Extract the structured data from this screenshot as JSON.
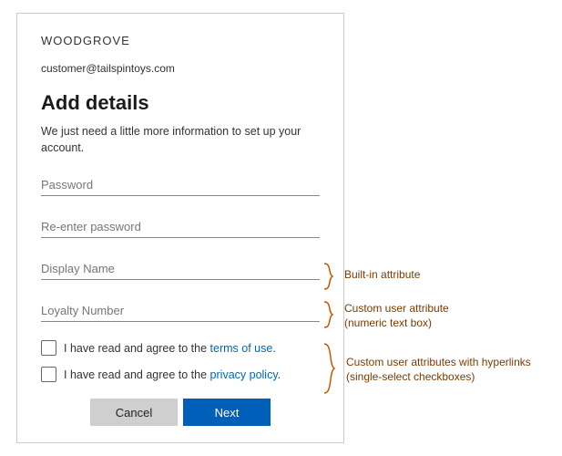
{
  "brand": "WOODGROVE",
  "email": "customer@tailspintoys.com",
  "title": "Add details",
  "subtitle": "We just need a little more information to set up your account.",
  "fields": {
    "password_ph": "Password",
    "reenter_ph": "Re-enter password",
    "display_ph": "Display Name",
    "loyalty_ph": "Loyalty Number"
  },
  "consent": {
    "prefix": "I have read and agree to the ",
    "terms_link": "terms of use",
    "privacy_link": "privacy policy",
    "suffix": "."
  },
  "buttons": {
    "cancel": "Cancel",
    "next": "Next"
  },
  "annotations": {
    "builtin": "Built-in attribute",
    "custom_numeric_l1": "Custom user attribute",
    "custom_numeric_l2": "(numeric text box)",
    "custom_checks_l1": "Custom user attributes with hyperlinks",
    "custom_checks_l2": "(single-select checkboxes)"
  }
}
